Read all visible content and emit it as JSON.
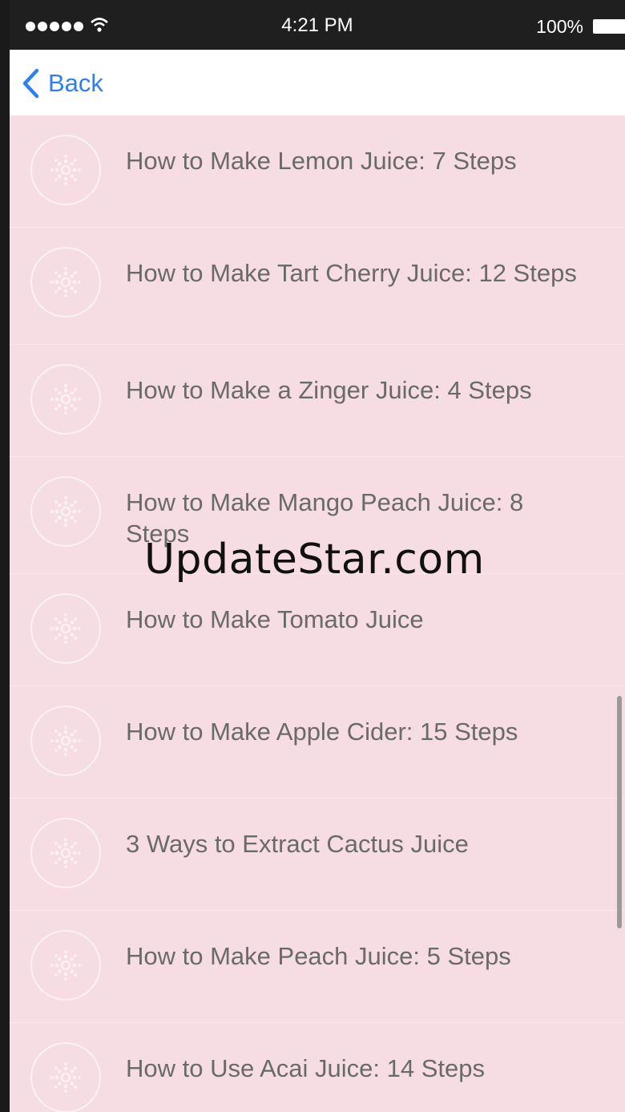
{
  "status_bar": {
    "time": "4:21 PM",
    "battery_percent": "100%"
  },
  "nav": {
    "back_label": "Back"
  },
  "articles": [
    "How to Make Lemon Juice: 7 Steps",
    "How to Make Tart Cherry Juice: 12 Steps",
    "How to Make a Zinger Juice: 4 Steps",
    "How to Make Mango Peach Juice: 8 Steps",
    "How to Make Tomato Juice",
    "How to Make Apple Cider: 15 Steps",
    "3 Ways to Extract Cactus Juice",
    "How to Make Peach Juice: 5 Steps",
    "How to Use Acai Juice: 14 Steps"
  ],
  "watermark": "UpdateStar.com",
  "icons": {
    "back": "chevron-left-icon",
    "thumbnail": "placeholder-dots-icon"
  },
  "colors": {
    "accent": "#2f7ff0",
    "list_background": "#f6dde3",
    "text": "#6a6a6a"
  }
}
